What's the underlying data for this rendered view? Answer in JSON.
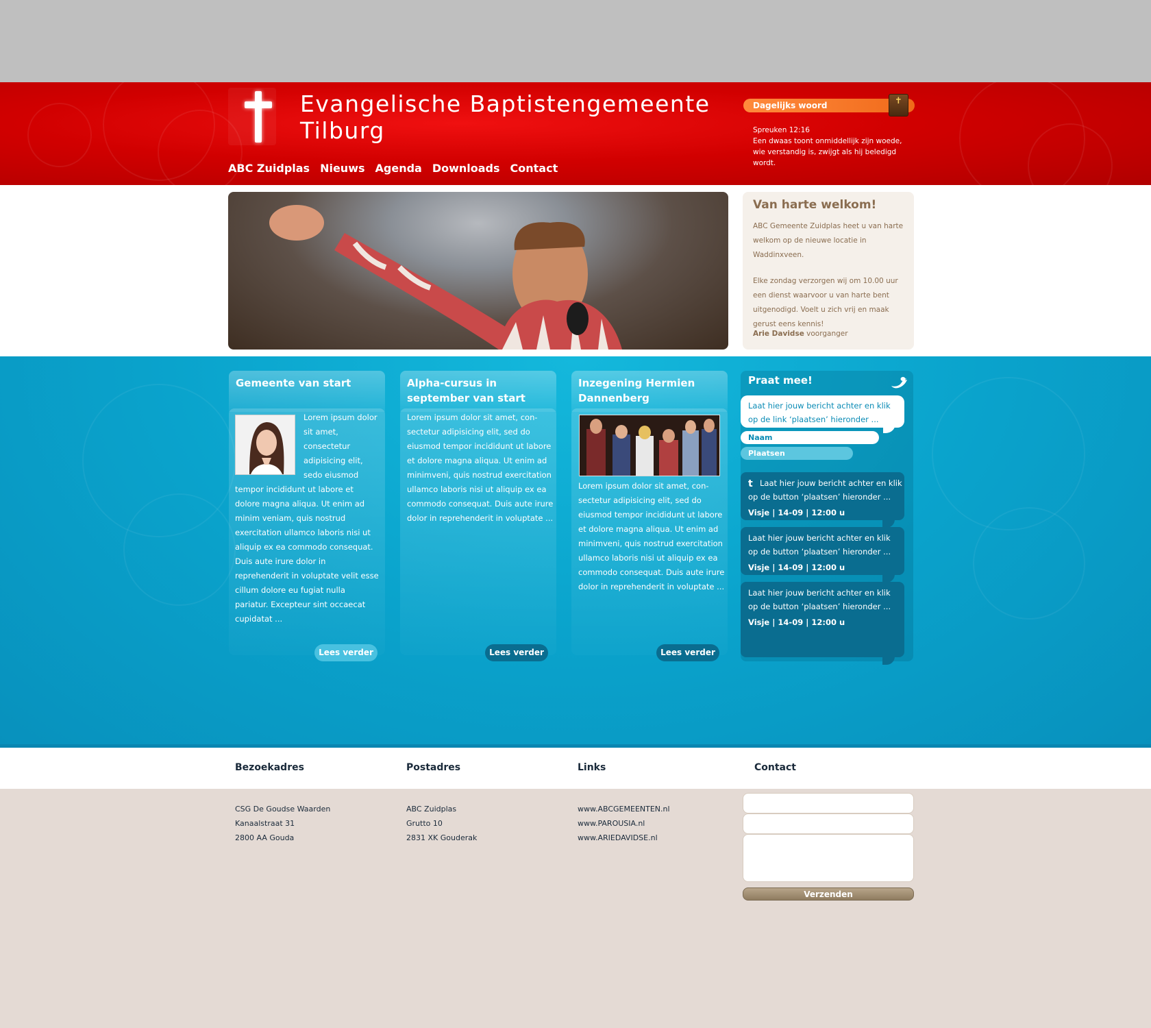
{
  "header": {
    "title_line1": "Evangelische Baptistengemeente",
    "title_line2": "Tilburg",
    "nav": [
      "ABC Zuidplas",
      "Nieuws",
      "Agenda",
      "Downloads",
      "Contact"
    ]
  },
  "daily_word": {
    "label": "Dagelijks woord",
    "reference": "Spreuken 12:16",
    "line1": "Een dwaas toont onmiddellijk zijn woede,",
    "line2": "wie verstandig is, zwijgt als hij beledigd wordt."
  },
  "welcome": {
    "title": "Van harte welkom!",
    "para1": "ABC Gemeente Zuidplas heet u van harte welkom op de nieuwe locatie in Waddinxveen.",
    "para2": "Elke zondag verzorgen wij om 10.00 uur een dienst waarvoor u van harte bent uitgenodigd. Voelt u zich vrij en maak gerust eens kennis!",
    "author": "Arie Davidse",
    "role": " voorganger"
  },
  "columns": [
    {
      "title": "Gemeente van start",
      "text_beside": "Lorem ipsum dolor sit amet, consectetur adipisicing elit, sedo eiusmod",
      "text_below": "tempor incididunt ut labore et dolore magna aliqua. Ut enim ad minim veniam, quis nostrud exercitation ullamco laboris nisi ut aliquip ex ea commodo consequat. Duis aute irure dolor in reprehenderit in voluptate velit esse cillum dolore eu fugiat nulla pariatur. Excepteur sint occaecat cupidatat ...",
      "button": "Lees verder"
    },
    {
      "title": "Alpha-cursus in september van start",
      "text": "Lorem ipsum dolor sit amet, con-sectetur adipisicing elit, sed do eiusmod tempor incididunt ut labore et dolore magna aliqua. Ut enim ad minimveni, quis nostrud exercitation ullamco laboris nisi ut aliquip ex ea commodo consequat. Duis aute irure dolor in reprehenderit in voluptate ...",
      "button": "Lees verder"
    },
    {
      "title": "Inzegening Hermien Dannenberg",
      "text": "Lorem ipsum dolor sit amet, con-sectetur adipisicing elit, sed do eiusmod tempor incididunt ut labore et dolore magna aliqua. Ut enim ad minimveni, quis nostrud exercitation ullamco laboris nisi ut aliquip ex ea commodo consequat. Duis aute irure dolor in reprehenderit in voluptate ...",
      "button": "Lees verder"
    }
  ],
  "twitter": {
    "title": "Praat mee!",
    "input_text": "Laat hier jouw bericht achter en klik op de link ‘plaatsen’ hieronder ...",
    "naam_label": "Naam",
    "plaatsen_label": "Plaatsen",
    "tweets": [
      {
        "text": "Laat hier jouw bericht achter en klik op de button ‘plaatsen’ hieronder ...",
        "meta": "Visje  |  14-09  |  12:00 u"
      },
      {
        "text": "Laat hier jouw bericht achter en klik op de button ‘plaatsen’ hieronder ...",
        "meta": "Visje  |  14-09  |  12:00 u"
      },
      {
        "text": "Laat hier jouw bericht achter en klik op de button ‘plaatsen’ hieronder ...",
        "meta": "Visje  |  14-09  |  12:00 u"
      }
    ]
  },
  "footer": {
    "bezoekadres": {
      "title": "Bezoekadres",
      "lines": [
        "CSG De Goudse Waarden",
        "Kanaalstraat 31",
        "2800 AA Gouda"
      ]
    },
    "postadres": {
      "title": "Postadres",
      "lines": [
        "ABC Zuidplas",
        "Grutto 10",
        "2831 XK Gouderak"
      ]
    },
    "links": {
      "title": "Links",
      "lines": [
        "www.ABCGEMEENTEN.nl",
        "www.PAROUSIA.nl",
        "www.ARIEDAVIDSE.nl"
      ]
    },
    "contact": {
      "title": "Contact",
      "submit": "Verzenden"
    }
  }
}
